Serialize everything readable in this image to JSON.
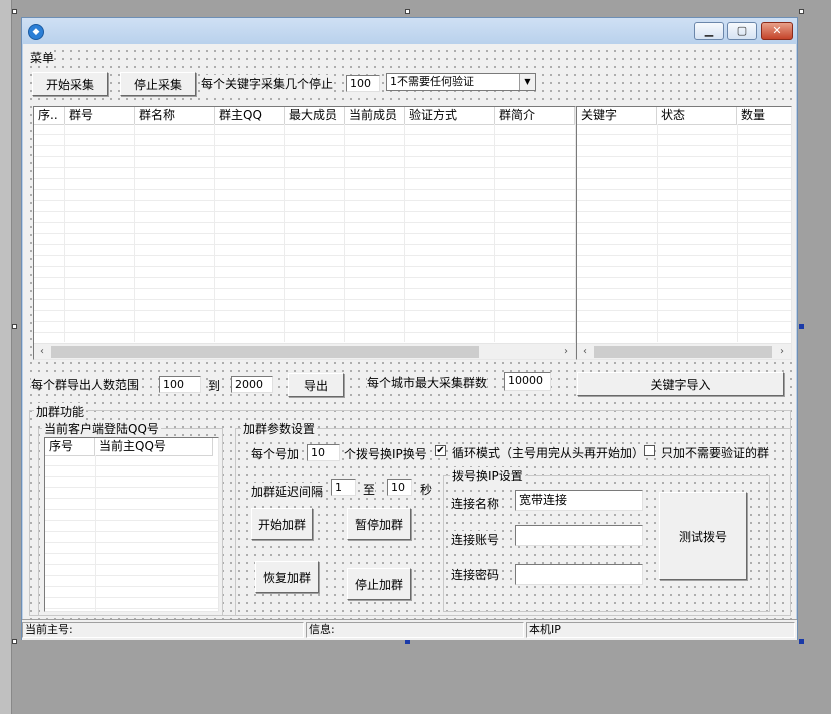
{
  "menu": {
    "label": "菜单"
  },
  "toolbar": {
    "start_collect": "开始采集",
    "stop_collect": "停止采集",
    "per_keyword_label": "每个关键字采集几个停止",
    "per_keyword_value": "100",
    "verify_select": "1不需要任何验证"
  },
  "group_table": {
    "columns": [
      "序..",
      "群号",
      "群名称",
      "群主QQ",
      "最大成员",
      "当前成员",
      "验证方式",
      "群简介"
    ]
  },
  "keyword_table": {
    "columns": [
      "关键字",
      "状态",
      "数量"
    ]
  },
  "export_row": {
    "range_label": "每个群导出人数范围",
    "from_value": "100",
    "to_label": "到",
    "to_value": "2000",
    "export_button": "导出",
    "city_max_label": "每个城市最大采集群数",
    "city_max_value": "10000",
    "keyword_import_button": "关键字导入"
  },
  "join_group": {
    "title": "加群功能",
    "client_group_title": "当前客户端登陆QQ号",
    "client_columns": [
      "序号",
      "当前主QQ号"
    ],
    "params_title": "加群参数设置",
    "per_number_label": "每个号加",
    "per_number_value": "10",
    "switch_ip_label": "个拨号换IP换号",
    "loop_mode_label": "循环模式（主号用完从头再开始加）",
    "loop_mode_checked": "✔",
    "no_verify_label": "只加不需要验证的群",
    "delay_label": "加群延迟间隔",
    "delay_from": "1",
    "delay_to_label": "至",
    "delay_to": "10",
    "delay_unit": "秒",
    "start_join": "开始加群",
    "pause_join": "暂停加群",
    "resume_join": "恢复加群",
    "stop_join": "停止加群",
    "dial_title": "拨号换IP设置",
    "conn_name_label": "连接名称",
    "conn_name_value": "宽带连接",
    "conn_account_label": "连接账号",
    "conn_password_label": "连接密码",
    "test_dial": "测试拨号"
  },
  "statusbar": {
    "current_main": "当前主号:",
    "info": "信息:",
    "local_ip": "本机IP"
  }
}
